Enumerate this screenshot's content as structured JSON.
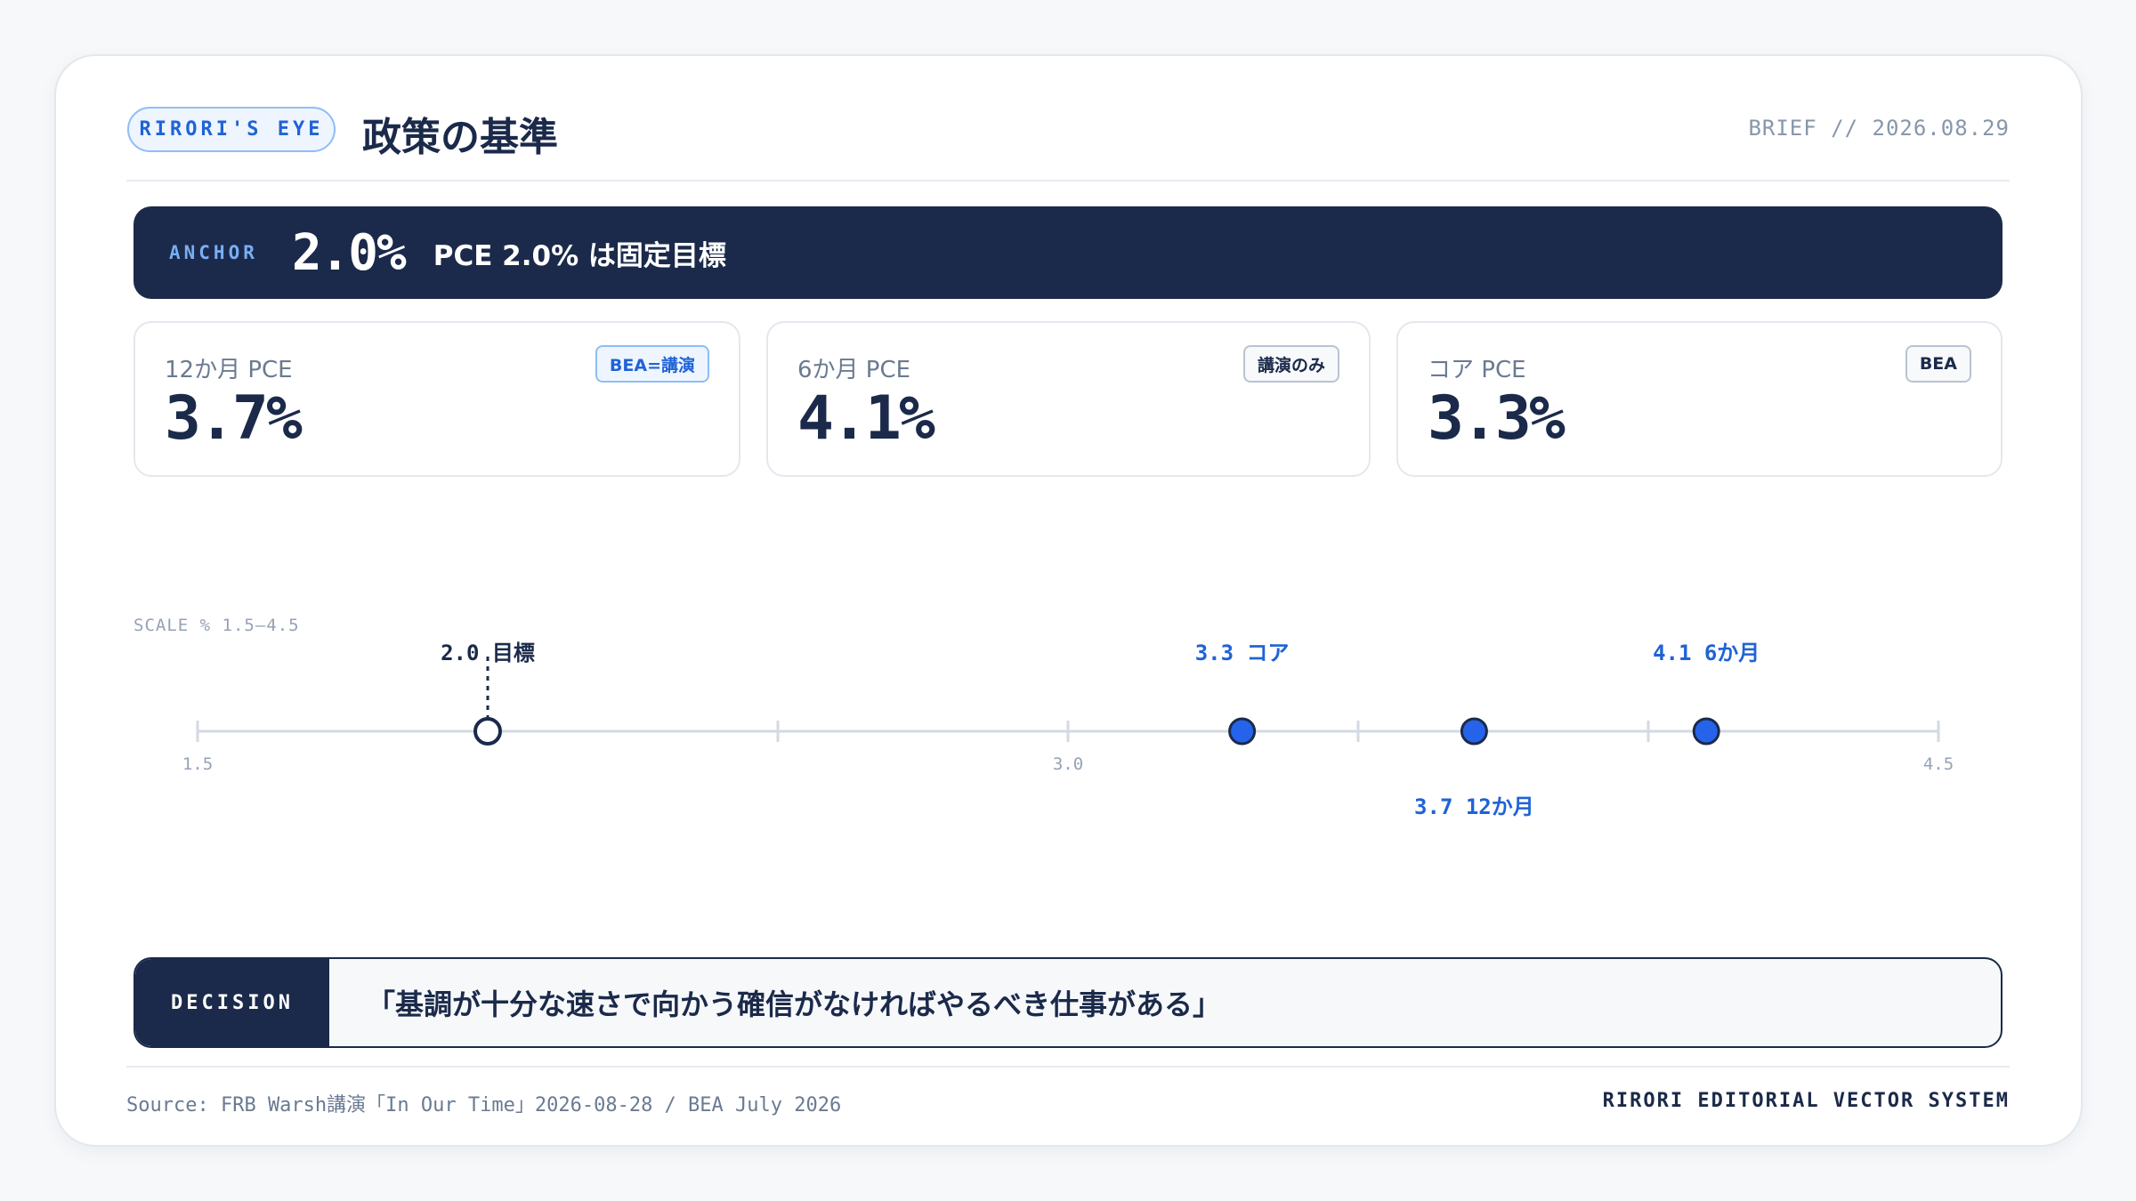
{
  "header": {
    "badge": "RIRORI'S EYE",
    "title": "政策の基準",
    "brief": "BRIEF // 2026.08.29"
  },
  "anchor": {
    "label": "ANCHOR",
    "value": "2.0%",
    "text": "PCE 2.0% は固定目標"
  },
  "metrics": [
    {
      "label": "12か月 PCE",
      "value": "3.7%",
      "badge": "BEA=講演",
      "badge_style": "blue"
    },
    {
      "label": "6か月 PCE",
      "value": "4.1%",
      "badge": "講演のみ",
      "badge_style": "gray"
    },
    {
      "label": "コア PCE",
      "value": "3.3%",
      "badge": "BEA",
      "badge_style": "gray"
    }
  ],
  "scale": {
    "label": "SCALE % 1.5–4.5",
    "min": 1.5,
    "max": 4.5,
    "ticks": [
      1.5,
      2.0,
      2.5,
      3.0,
      3.5,
      4.0,
      4.5
    ],
    "tick_labels": [
      {
        "value": 1.5,
        "text": "1.5"
      },
      {
        "value": 3.0,
        "text": "3.0"
      },
      {
        "value": 4.5,
        "text": "4.5"
      }
    ],
    "markers": [
      {
        "value": 2.0,
        "text": "2.0 目標",
        "kind": "target",
        "label_pos": "above"
      },
      {
        "value": 3.3,
        "text": "3.3 コア",
        "kind": "point",
        "label_pos": "above"
      },
      {
        "value": 3.7,
        "text": "3.7 12か月",
        "kind": "point",
        "label_pos": "below"
      },
      {
        "value": 4.1,
        "text": "4.1 6か月",
        "kind": "point",
        "label_pos": "above"
      }
    ],
    "colors": {
      "line": "#d3dae3",
      "point": "#2563eb",
      "target": "#1b2a4a",
      "label_point": "#1f63d6"
    }
  },
  "decision": {
    "label": "DECISION",
    "text": "「基調が十分な速さで向かう確信がなければやるべき仕事がある」"
  },
  "footer": {
    "source": "Source: FRB Warsh講演「In Our Time」2026-08-28 / BEA July 2026",
    "system": "RIRORI EDITORIAL VECTOR SYSTEM"
  }
}
